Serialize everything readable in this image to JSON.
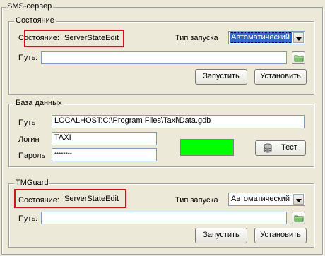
{
  "sms_server": {
    "title": "SMS-сервер",
    "state_group": {
      "title": "Состояние",
      "state_label": "Состояние:",
      "state_value": "ServerStateEdit",
      "launch_type_label": "Тип запуска",
      "launch_type_value": "Автоматический",
      "path_label": "Путь:",
      "path_value": "",
      "start_button": "Запустить",
      "install_button": "Установить"
    },
    "database_group": {
      "title": "База данных",
      "path_label": "Путь",
      "path_value": "LOCALHOST:C:\\Program Files\\Taxi\\Data.gdb",
      "login_label": "Логин",
      "login_value": "TAXI",
      "password_label": "Пароль",
      "password_value": "********",
      "status_color": "#00ff00",
      "test_button": "Тест",
      "test_icon": "database-icon"
    },
    "tmguard_group": {
      "title": "TMGuard",
      "state_label": "Состояние:",
      "state_value": "ServerStateEdit",
      "launch_type_label": "Тип запуска",
      "launch_type_value": "Автоматический",
      "path_label": "Путь:",
      "path_value": "",
      "start_button": "Запустить",
      "install_button": "Установить"
    }
  },
  "colors": {
    "highlight_box": "#d0121b",
    "selection": "#316ac5"
  }
}
